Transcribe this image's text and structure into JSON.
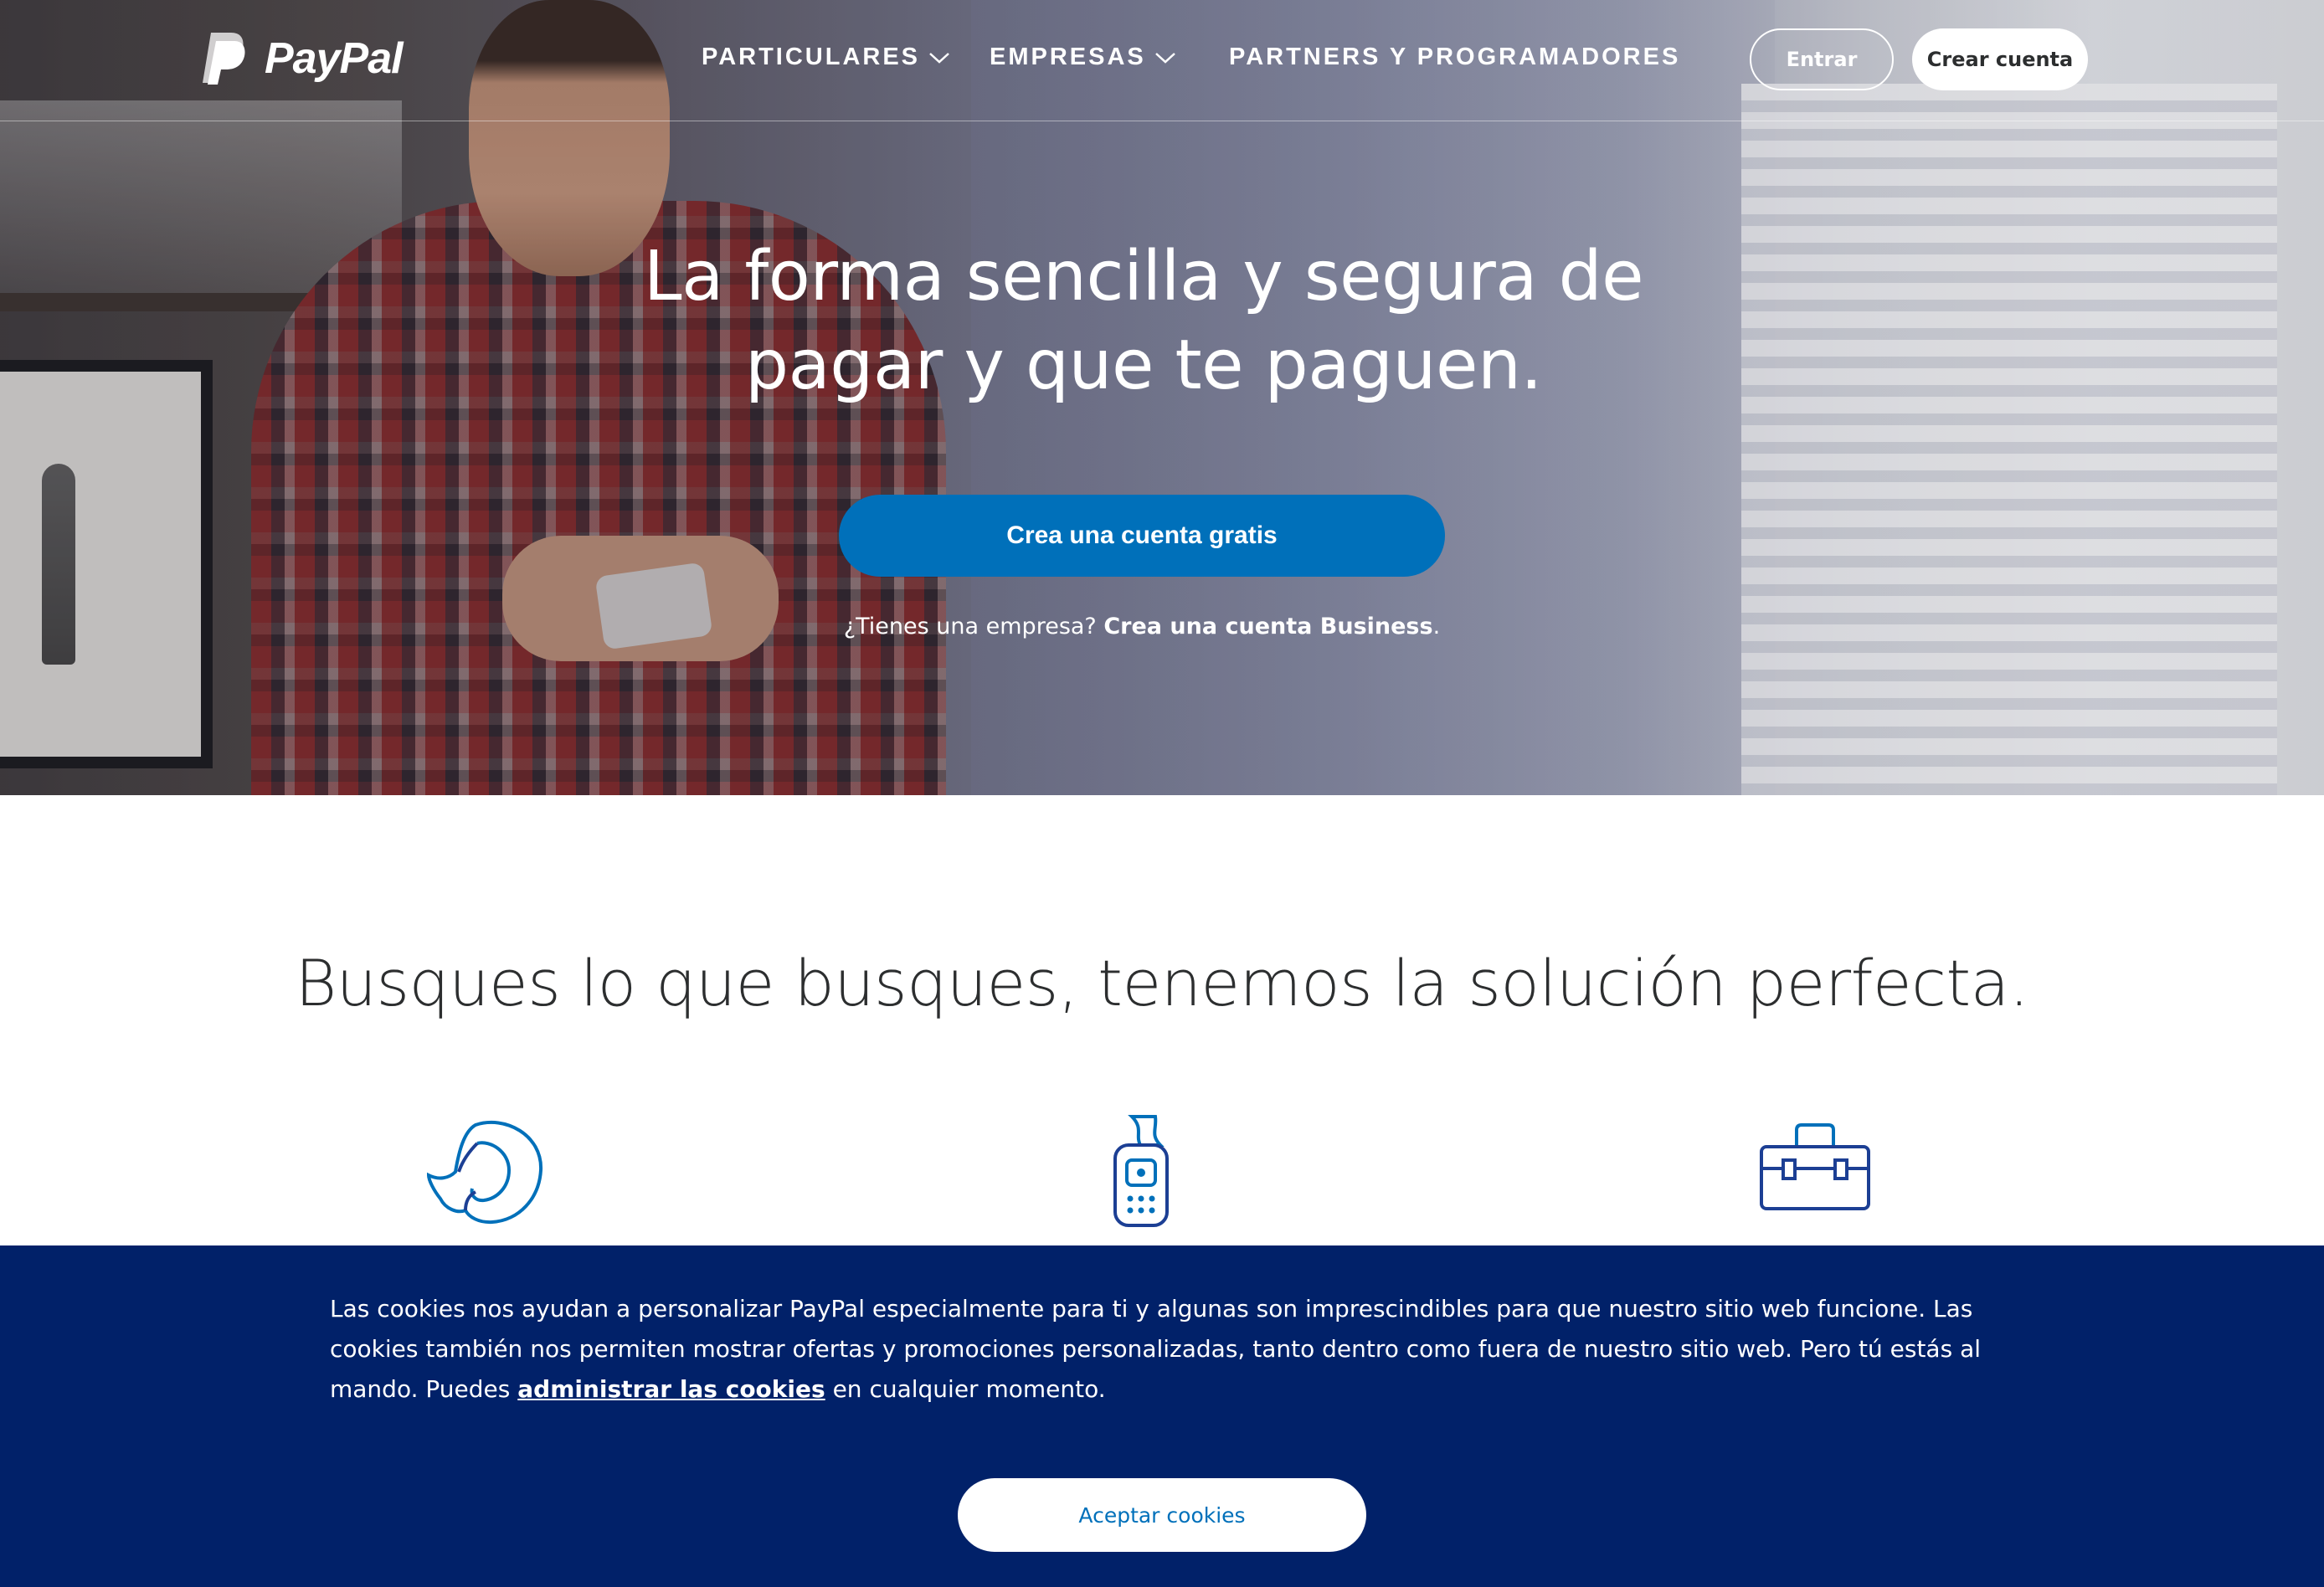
{
  "nav": {
    "brand": "PayPal",
    "links": [
      {
        "label": "PARTICULARES",
        "has_dropdown": true
      },
      {
        "label": "EMPRESAS",
        "has_dropdown": true
      },
      {
        "label": "PARTNERS Y PROGRAMADORES",
        "has_dropdown": false
      }
    ],
    "login_label": "Entrar",
    "signup_label": "Crear cuenta"
  },
  "hero": {
    "title_line1": "La forma sencilla y segura de",
    "title_line2": "pagar y que te paguen.",
    "cta_label": "Crea una cuenta gratis",
    "business_prompt": "¿Tienes una empresa?",
    "business_link": "Crea una cuenta Business",
    "business_suffix": "."
  },
  "solutions": {
    "title": "Busques lo que busques, tenemos la solución perfecta.",
    "icons": [
      "person-profile-icon",
      "card-reader-icon",
      "toolbox-icon"
    ]
  },
  "cookies": {
    "text_part1": "Las cookies nos ayudan a personalizar PayPal especialmente para ti y algunas son imprescindibles para que nuestro sitio web funcione. Las cookies también nos permiten mostrar ofertas y promociones personalizadas, tanto dentro como fuera de nuestro sitio web. Pero tú estás al mando. Puedes",
    "manage_link": "administrar las cookies",
    "text_part2": "en cualquier momento.",
    "accept_label": "Aceptar cookies"
  },
  "colors": {
    "primary_blue": "#0070ba",
    "cookie_bar_navy": "#012169",
    "icon_blue": "#0070ba",
    "icon_navy": "#1c3f94",
    "text_dark": "#2c2e2f"
  }
}
